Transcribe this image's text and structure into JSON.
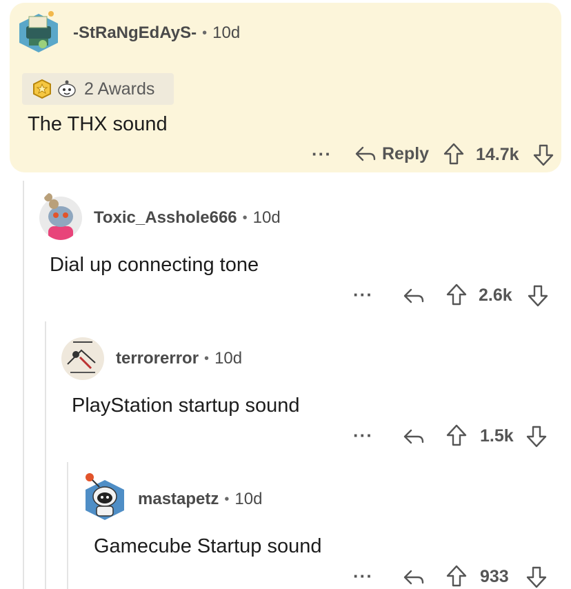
{
  "colors": {
    "highlight_bg": "#fcf5da",
    "text": "#1c1c1c",
    "meta": "#4a4a4a",
    "thread_line": "#e4e4e4"
  },
  "comments": [
    {
      "username": "-StRaNgEdAyS-",
      "age": "10d",
      "awards_label": "2 Awards",
      "body": "The THX sound",
      "reply_label": "Reply",
      "score": "14.7k",
      "avatar_icon": "typewriter-avatar"
    },
    {
      "username": "Toxic_Asshole666",
      "age": "10d",
      "body": "Dial up connecting tone",
      "score": "2.6k",
      "avatar_icon": "snoo-avatar"
    },
    {
      "username": "terrorerror",
      "age": "10d",
      "body": "PlayStation startup sound",
      "score": "1.5k",
      "avatar_icon": "illustration-avatar"
    },
    {
      "username": "mastapetz",
      "age": "10d",
      "body": "Gamecube Startup sound",
      "score": "933",
      "avatar_icon": "robot-snoo-avatar"
    }
  ],
  "separators": {
    "dot": "•",
    "more": "···"
  }
}
